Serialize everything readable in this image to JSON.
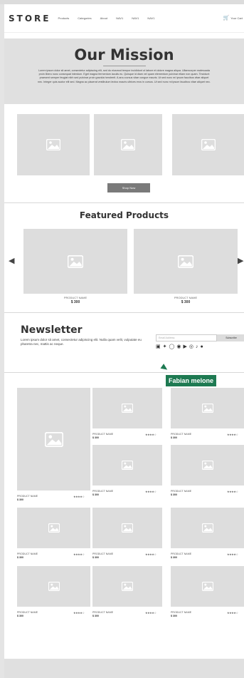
{
  "nav": {
    "logo": "STORE",
    "links": [
      "Products",
      "Categories",
      "About",
      "NAV1",
      "NAV1",
      "NAV1"
    ],
    "cart_label": "Your Cart",
    "cart_icon": "cart-icon"
  },
  "hero": {
    "title": "Our Mission",
    "body": "Lorem ipsum dolor sit amet, consectetur adipiscing elit, sed do eiusmod tempor incididunt ut labore et dolore magna aliqua. Ullamcorper malesuada proin libero nunc consequat interdum. Eget magna fermentum iaculis eu. Quisque id diam vel quam elementum pulvinar etiam non quam. Tincidunt praesent semper feugiat nibh sed pulvinar proin gravida hendrerit. A arcu cursus vitae congue mauris. Ut sed nunc mi ipsum faucibus vitae aliquet nec. Integer quis auctor elit sed. Magna ac placerat vestibulum lectus mauris ultrices eros in cursus. Ut sed nunc mi ipsum faucibus vitae aliquet nec."
  },
  "shop_button": "Shop Now",
  "featured": {
    "title": "Featured Products",
    "products": [
      {
        "name": "PRODUCT NAME",
        "price": "$ 300"
      },
      {
        "name": "PRODUCT NAME",
        "price": "$ 300"
      }
    ]
  },
  "newsletter": {
    "title": "Newsletter",
    "text": "Lorem ipsum dolor sit amet, consectetur adipiscing elit. Nulla quam velit, vulputate eu pharetra nec, mattis ac neque.",
    "email_placeholder": "Email Address",
    "subscribe": "Subscribe",
    "socials": [
      "linkedin-icon",
      "twitter-icon",
      "instagram-icon",
      "github-icon",
      "youtube-icon",
      "pinterest-icon",
      "tiktok-icon",
      "reddit-icon"
    ]
  },
  "cursor_label": "Fabian melone",
  "grid": {
    "product_name": "PRODUCT NAME",
    "price": "$ 300",
    "stars": "★★★★☆",
    "rating": 4
  }
}
